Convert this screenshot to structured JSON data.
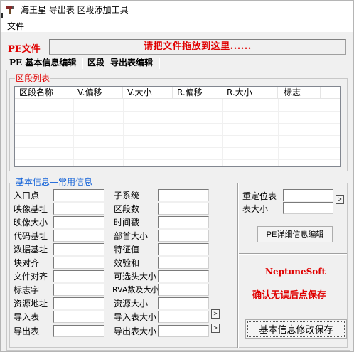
{
  "window": {
    "title": "海王星 导出表 区段添加工具"
  },
  "menu": {
    "file": "文件"
  },
  "pe": {
    "label": "PE文件",
    "drop_hint": "请把文件拖放到这里......"
  },
  "tabs": [
    {
      "label": "PE 基本信息编辑"
    },
    {
      "label": "区段"
    },
    {
      "label": "导出表编辑"
    }
  ],
  "section_list": {
    "title": "区段列表",
    "columns": [
      "区段名称",
      "V.偏移",
      "V.大小",
      "R.偏移",
      "R.大小",
      "标志"
    ]
  },
  "basic_info": {
    "title": "基本信息—常用信息",
    "left_fields": [
      {
        "label": "入口点",
        "value": ""
      },
      {
        "label": "映像基址",
        "value": ""
      },
      {
        "label": "映像大小",
        "value": ""
      },
      {
        "label": "代码基址",
        "value": ""
      },
      {
        "label": "数据基址",
        "value": ""
      },
      {
        "label": "块对齐",
        "value": ""
      },
      {
        "label": "文件对齐",
        "value": ""
      },
      {
        "label": "标志字",
        "value": ""
      },
      {
        "label": "资源地址",
        "value": ""
      },
      {
        "label": "导入表",
        "value": ""
      },
      {
        "label": "导出表",
        "value": ""
      }
    ],
    "right_fields": [
      {
        "label": "子系统",
        "value": ""
      },
      {
        "label": "区段数",
        "value": ""
      },
      {
        "label": "时间戳",
        "value": ""
      },
      {
        "label": "部首大小",
        "value": ""
      },
      {
        "label": "特征值",
        "value": ""
      },
      {
        "label": "效验和",
        "value": ""
      },
      {
        "label": "可选头大小",
        "value": ""
      },
      {
        "label": "RVA数及大小",
        "value": ""
      },
      {
        "label": "资源大小",
        "value": ""
      },
      {
        "label": "导入表大小",
        "value": ""
      },
      {
        "label": "导出表大小",
        "value": ""
      }
    ]
  },
  "reloc": {
    "reloc_label": "重定位表",
    "table_size_label": "表大小",
    "reloc_value": "",
    "table_size_value": ""
  },
  "buttons": {
    "pe_detail": "PE详细信息编辑",
    "save": "基本信息修改保存",
    "arrow": ">"
  },
  "brand": "NeptuneSoft",
  "save_hint": "确认无误后点保存",
  "colors": {
    "accent_red": "#e00000",
    "group_blue": "#1060d8"
  }
}
